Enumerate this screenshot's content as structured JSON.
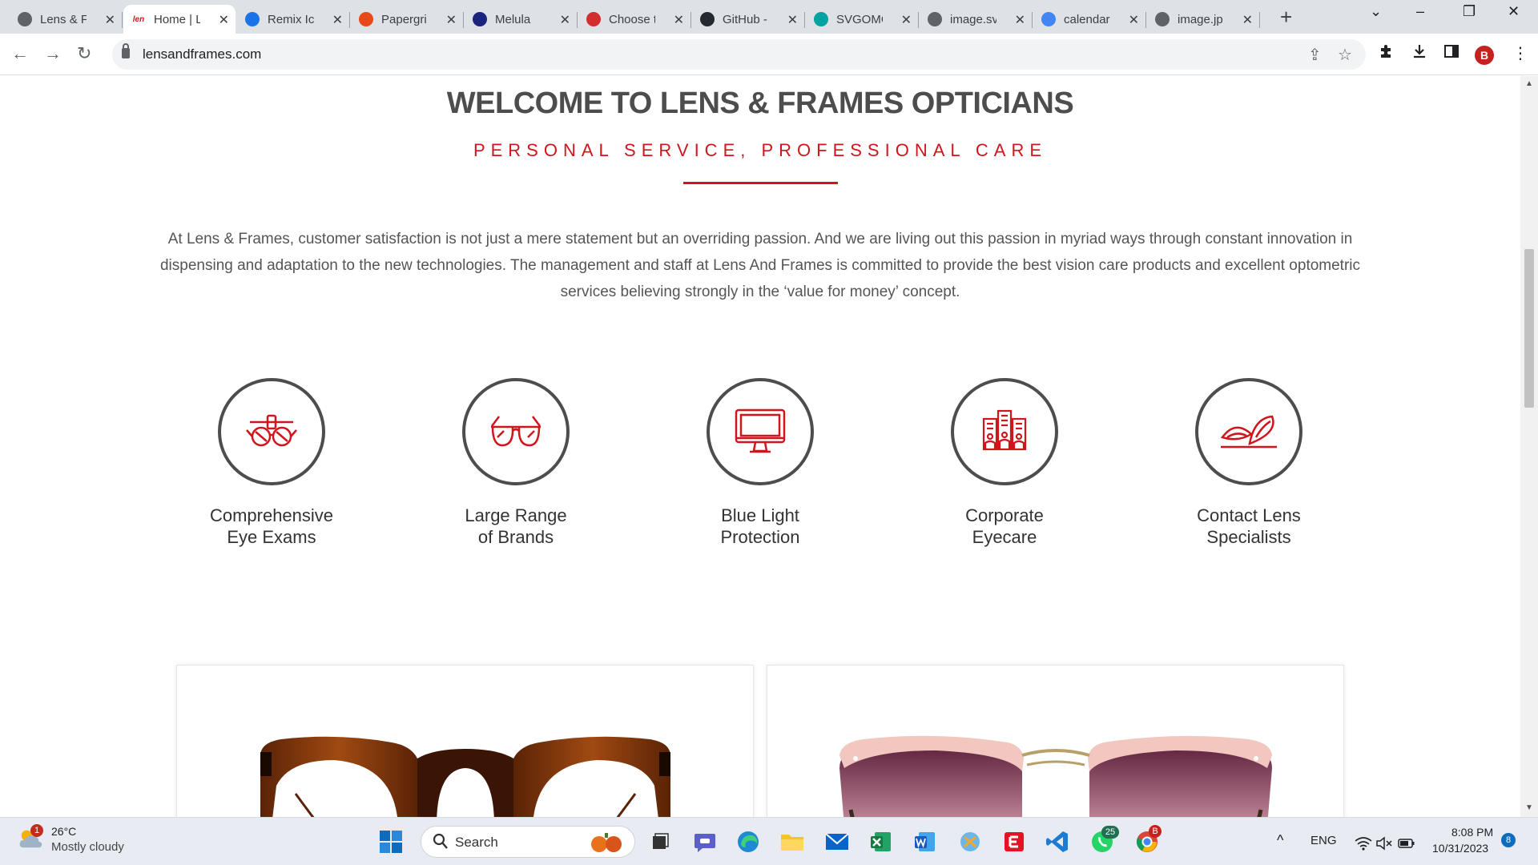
{
  "browser": {
    "tabs": [
      {
        "title": "Lens & F",
        "active": false,
        "favicon_color": "#5f6368",
        "favicon_text": ""
      },
      {
        "title": "Home | L",
        "active": true,
        "favicon_color": "#ffffff",
        "favicon_text": "len"
      },
      {
        "title": "Remix Ic",
        "active": false,
        "favicon_color": "#1a73e8",
        "favicon_text": ""
      },
      {
        "title": "Papergri",
        "active": false,
        "favicon_color": "#e64a19",
        "favicon_text": ""
      },
      {
        "title": "Melula",
        "active": false,
        "favicon_color": "#1a237e",
        "favicon_text": ""
      },
      {
        "title": "Choose t",
        "active": false,
        "favicon_color": "#d32f2f",
        "favicon_text": ""
      },
      {
        "title": "GitHub -",
        "active": false,
        "favicon_color": "#24292f",
        "favicon_text": ""
      },
      {
        "title": "SVGOMG",
        "active": false,
        "favicon_color": "#00a2a2",
        "favicon_text": ""
      },
      {
        "title": "image.sv",
        "active": false,
        "favicon_color": "#5f6368",
        "favicon_text": ""
      },
      {
        "title": "calendar",
        "active": false,
        "favicon_color": "#4285f4",
        "favicon_text": ""
      },
      {
        "title": "image.jp",
        "active": false,
        "favicon_color": "#5f6368",
        "favicon_text": ""
      }
    ],
    "url": "lensandframes.com",
    "profile_initial": "B"
  },
  "page": {
    "heading": "WELCOME TO LENS & FRAMES OPTICIANS",
    "tagline": "PERSONAL SERVICE, PROFESSIONAL CARE",
    "intro": "At Lens & Frames, customer satisfaction is not just a mere statement but an overriding passion. And we are living out this passion in myriad ways through constant innovation in dispensing and adaptation to the new technologies. The management and staff at Lens And Frames is committed to provide the best vision care products and excellent optometric services believing strongly in the ‘value for money’ concept.",
    "features": [
      {
        "line1": "Comprehensive",
        "line2": "Eye Exams",
        "icon": "eye-exam-icon"
      },
      {
        "line1": "Large Range",
        "line2": "of Brands",
        "icon": "glasses-icon"
      },
      {
        "line1": "Blue Light",
        "line2": "Protection",
        "icon": "monitor-icon"
      },
      {
        "line1": "Corporate",
        "line2": "Eyecare",
        "icon": "corporate-building-icon"
      },
      {
        "line1": "Contact Lens",
        "line2": "Specialists",
        "icon": "contact-lens-icon"
      }
    ],
    "products": [
      {
        "name": "tortoise-frame-glasses"
      },
      {
        "name": "pink-clubmaster-sunglasses"
      }
    ],
    "colors": {
      "accent": "#d0151c",
      "heading": "#4d4d4d",
      "body": "#555555"
    }
  },
  "taskbar": {
    "weather": {
      "temp": "26°C",
      "condition": "Mostly cloudy",
      "alert_count": "1"
    },
    "search_label": "Search",
    "language": "ENG",
    "time": "8:08 PM",
    "date": "10/31/2023",
    "notification_count": "8",
    "whatsapp_badge": "25",
    "chrome_badge": "B"
  }
}
